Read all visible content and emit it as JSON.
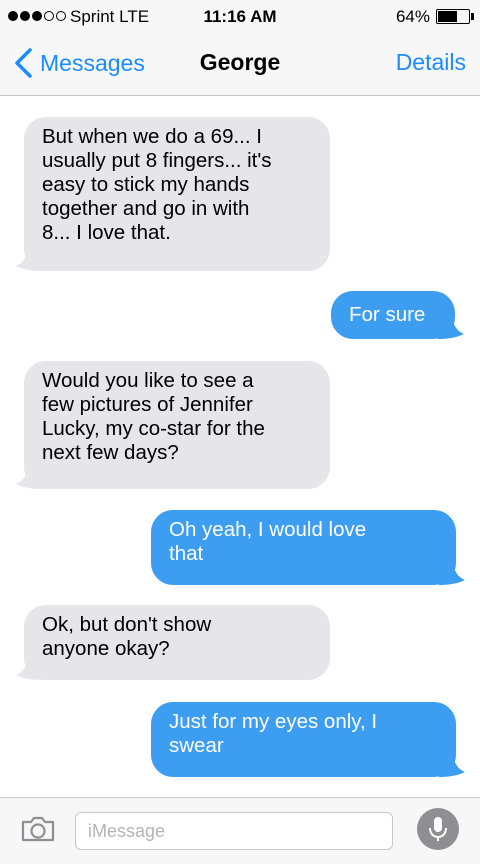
{
  "status_bar": {
    "signal_bars": "●●●○○",
    "carrier": "Sprint  LTE",
    "time": "11:16 AM",
    "battery_percent": "64%",
    "battery_level": 0.64
  },
  "nav": {
    "back_label": "Messages",
    "title": "George",
    "details_label": "Details"
  },
  "messages": [
    {
      "direction": "incoming",
      "text": "But when we do a 69... I\nusually put 8 fingers... it's\neasy to stick my hands\ntogether and go in with\n8... I love that."
    },
    {
      "direction": "outgoing",
      "text": "For sure"
    },
    {
      "direction": "incoming",
      "text": "Would you like to see a\nfew pictures of Jennifer\nLucky, my co-star for the\nnext few days?"
    },
    {
      "direction": "outgoing",
      "text": "Oh yeah, I would love\nthat"
    },
    {
      "direction": "incoming",
      "text": "Ok, but don't show\nanyone okay?"
    },
    {
      "direction": "outgoing",
      "text": "Just for my eyes only, I\nswear"
    }
  ],
  "input": {
    "placeholder": "iMessage",
    "value": ""
  },
  "icons": {
    "back": "chevron-left-icon",
    "camera": "camera-icon",
    "mic": "microphone-icon"
  },
  "colors": {
    "accent": "#1a8cff",
    "outgoing_bubble": "#3d9df0",
    "incoming_bubble": "#e5e5ea"
  }
}
